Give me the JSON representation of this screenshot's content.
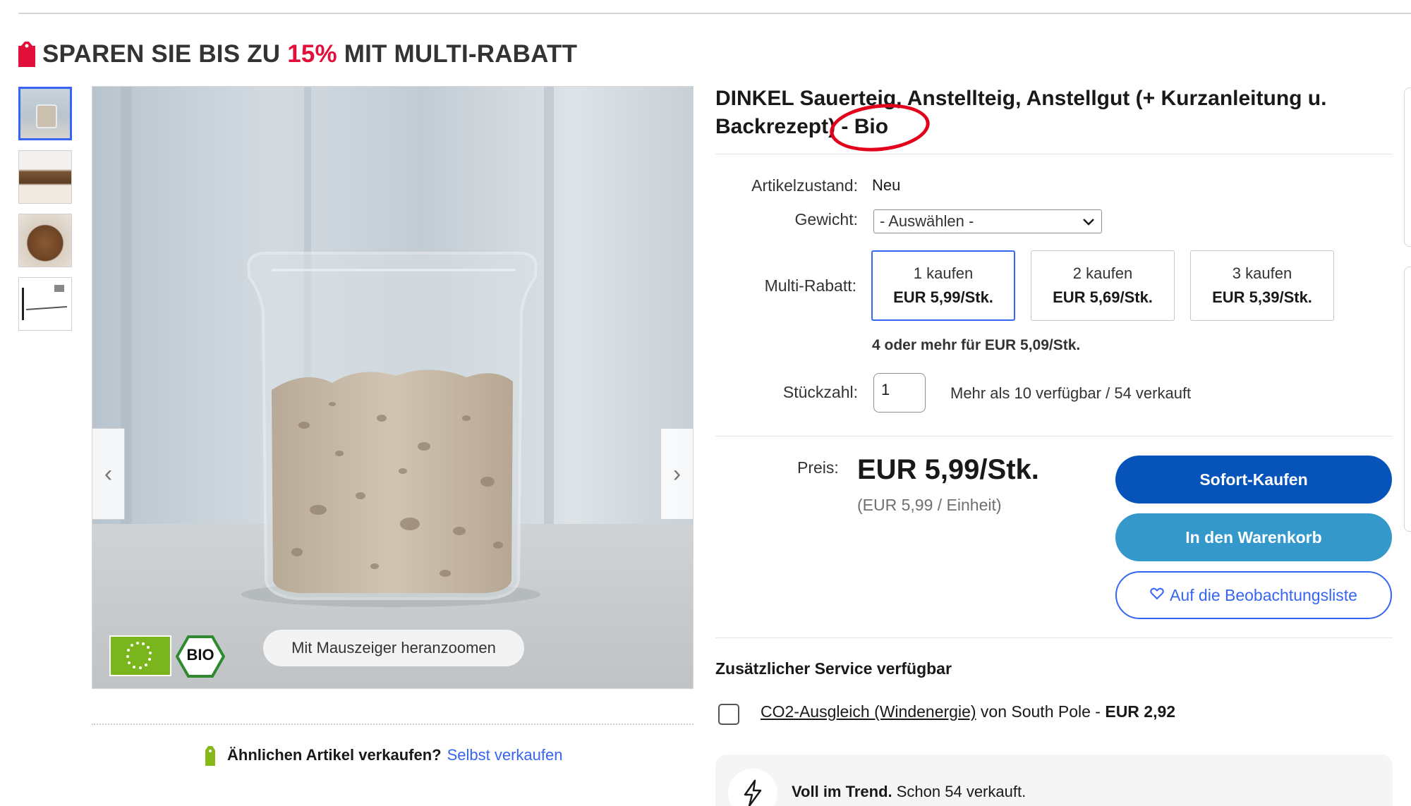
{
  "promo": {
    "prefix": "SPAREN SIE BIS ZU ",
    "percent": "15%",
    "suffix": " MIT MULTI-RABATT",
    "accent_color": "#e0103a"
  },
  "gallery": {
    "thumbnails": [
      {
        "name": "thumbnail-1",
        "selected": true
      },
      {
        "name": "thumbnail-2",
        "selected": false
      },
      {
        "name": "thumbnail-3",
        "selected": false
      },
      {
        "name": "thumbnail-4",
        "selected": false
      }
    ],
    "zoom_hint": "Mit Mauszeiger heranzoomen",
    "prev_icon": "chevron-left-icon",
    "next_icon": "chevron-right-icon",
    "bio_badge": "BIO"
  },
  "sell_similar": {
    "question": "Ähnlichen Artikel verkaufen?",
    "link": "Selbst verkaufen"
  },
  "product": {
    "title": "DINKEL Sauerteig, Anstellteig, Anstellgut (+ Kurzanleitung u. Backrezept) - Bio",
    "condition_label": "Artikelzustand:",
    "condition_value": "Neu",
    "weight_label": "Gewicht:",
    "weight_selected": "- Auswählen -",
    "multi_label": "Multi-Rabatt:",
    "multi_options": [
      {
        "qty": "1 kaufen",
        "price": "EUR 5,99/Stk.",
        "selected": true
      },
      {
        "qty": "2 kaufen",
        "price": "EUR 5,69/Stk.",
        "selected": false
      },
      {
        "qty": "3 kaufen",
        "price": "EUR 5,39/Stk.",
        "selected": false
      }
    ],
    "multi_note": "4 oder mehr für EUR 5,09/Stk.",
    "qty_label": "Stückzahl:",
    "qty_value": "1",
    "availability": "Mehr als 10 verfügbar / 54 verkauft",
    "price_label": "Preis:",
    "price": "EUR 5,99/Stk.",
    "unit_price": "(EUR 5,99 / Einheit)"
  },
  "actions": {
    "buy_now": "Sofort-Kaufen",
    "add_to_cart": "In den Warenkorb",
    "watch": "Auf die Beobachtungsliste",
    "buy_color": "#0654ba",
    "cart_color": "#3498ca"
  },
  "service": {
    "title": "Zusätzlicher Service verfügbar",
    "option_link": "CO2-Ausgleich (Windenergie)",
    "option_mid": " von South Pole - ",
    "option_price": "EUR 2,92"
  },
  "trend": {
    "bold": "Voll im Trend.",
    "text": " Schon 54 verkauft.",
    "icon": "lightning-icon"
  }
}
